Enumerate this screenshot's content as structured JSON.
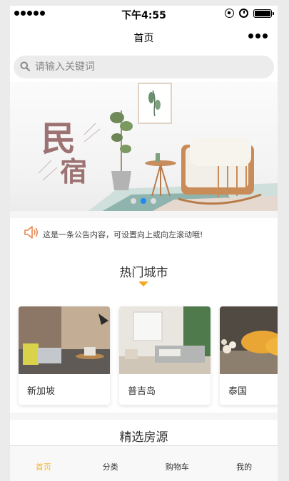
{
  "status_bar": {
    "time": "下午4:55"
  },
  "navbar": {
    "title": "首页"
  },
  "search": {
    "placeholder": "请输入关键词"
  },
  "banner": {
    "headline_top": "民",
    "headline_bottom": "宿",
    "slide_count": 3,
    "active_slide": 1
  },
  "notice": {
    "text": "这是一条公告内容，可设置向上或向左滚动哦!"
  },
  "hot_cities": {
    "title": "热门城市",
    "items": [
      {
        "name": "新加坡"
      },
      {
        "name": "普吉岛"
      },
      {
        "name": "泰国"
      }
    ]
  },
  "featured": {
    "title": "精选房源"
  },
  "tabbar": {
    "items": [
      {
        "label": "首页"
      },
      {
        "label": "分类"
      },
      {
        "label": "购物车"
      },
      {
        "label": "我的"
      }
    ],
    "active_index": 0
  },
  "colors": {
    "accent": "#f2b735",
    "caret": "#f5a623",
    "indicator": "#1b8bf5",
    "banner_text": "#9c7272"
  }
}
